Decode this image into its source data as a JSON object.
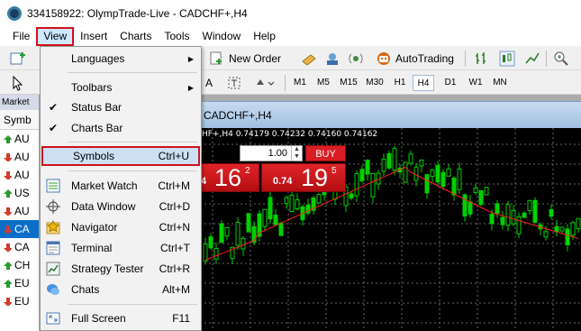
{
  "window": {
    "title": "334158922: OlympTrade-Live - CADCHF+,H4"
  },
  "menubar": {
    "items": [
      "File",
      "View",
      "Insert",
      "Charts",
      "Tools",
      "Window",
      "Help"
    ]
  },
  "toolbar": {
    "new_order": "New Order",
    "autotrading": "AutoTrading"
  },
  "timeframes": [
    "M1",
    "M5",
    "M15",
    "M30",
    "H1",
    "H4",
    "D1",
    "W1",
    "MN"
  ],
  "active_timeframe": "H4",
  "market_watch": {
    "title": "Market",
    "header": "Symb",
    "rows": [
      {
        "label": "AU",
        "dir": "up"
      },
      {
        "label": "AU",
        "dir": "down"
      },
      {
        "label": "AU",
        "dir": "down"
      },
      {
        "label": "US",
        "dir": "up"
      },
      {
        "label": "AU",
        "dir": "down"
      },
      {
        "label": "CA",
        "dir": "down",
        "selected": true
      },
      {
        "label": "CA",
        "dir": "down"
      },
      {
        "label": "CH",
        "dir": "up"
      },
      {
        "label": "EU",
        "dir": "up"
      },
      {
        "label": "EU",
        "dir": "down"
      }
    ]
  },
  "view_menu": {
    "items": [
      {
        "label": "Languages",
        "submenu": true
      },
      {
        "label": "Toolbars",
        "submenu": true
      },
      {
        "label": "Status Bar",
        "checked": true
      },
      {
        "label": "Charts Bar",
        "checked": true
      },
      {
        "label": "Symbols",
        "shortcut": "Ctrl+U",
        "highlighted": true
      },
      {
        "label": "Market Watch",
        "shortcut": "Ctrl+M"
      },
      {
        "label": "Data Window",
        "shortcut": "Ctrl+D"
      },
      {
        "label": "Navigator",
        "shortcut": "Ctrl+N"
      },
      {
        "label": "Terminal",
        "shortcut": "Ctrl+T"
      },
      {
        "label": "Strategy Tester",
        "shortcut": "Ctrl+R"
      },
      {
        "label": "Chats",
        "shortcut": "Alt+M"
      },
      {
        "label": "Full Screen",
        "shortcut": "F11"
      }
    ]
  },
  "chart": {
    "window_title": "CADCHF+,H4",
    "info_line": "HF+,H4  0.74179 0.74232 0.74160 0.74162",
    "lot_value": "1.00",
    "buy_label": "BUY",
    "sell_price": {
      "small": "4",
      "big": "16",
      "sup": "2"
    },
    "buy_price": {
      "small": "0.74",
      "big": "19",
      "sup": "5"
    },
    "colors": {
      "bull": "#00d000",
      "ma": "#ff2020",
      "background": "#000000"
    }
  }
}
